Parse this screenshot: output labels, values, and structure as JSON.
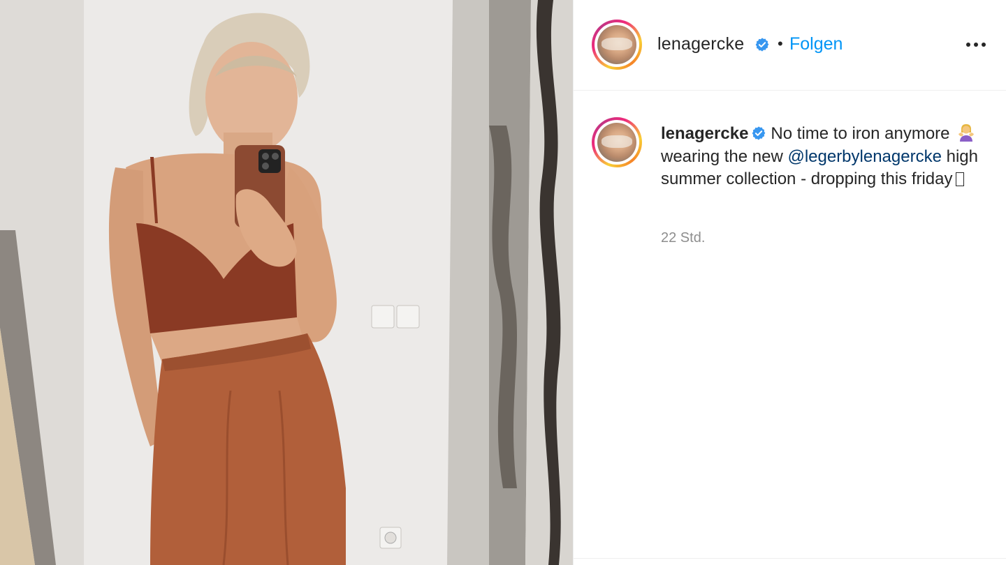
{
  "post": {
    "author": {
      "username": "lenagercke",
      "verified_icon": "verified-badge-icon",
      "separator": "•",
      "follow_label": "Folgen"
    },
    "more_icon": "more-options-icon",
    "caption": {
      "username": "lenagercke",
      "text_part1": "No time to iron anymore",
      "emoji_name": "woman-shrugging-emoji",
      "text_part2": "wearing the new",
      "mention": "@legerbylenagercke",
      "text_part3": "high summer collection - dropping this friday"
    },
    "timestamp": "22 Std."
  },
  "colors": {
    "link_blue": "#0095f6",
    "mention_blue": "#00376b",
    "verified_blue": "#3897f0",
    "text": "#262626",
    "muted": "#8e8e8e"
  }
}
